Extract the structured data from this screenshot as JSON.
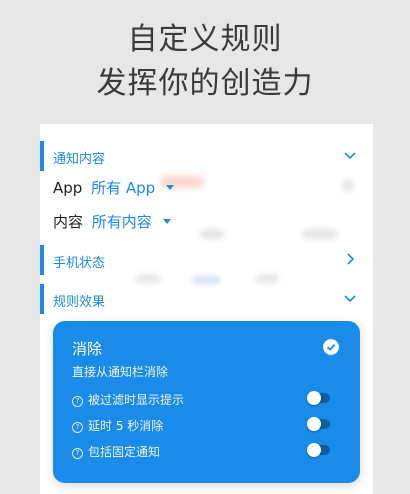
{
  "promo": {
    "line1": "自定义规则",
    "line2": "发挥你的创造力"
  },
  "sections": {
    "notification_content": "通知内容",
    "phone_state": "手机状态",
    "rule_effect": "规则效果"
  },
  "filters": {
    "app_label": "App",
    "app_value": "所有 App",
    "content_label": "内容",
    "content_value": "所有内容"
  },
  "effect_panel": {
    "title": "消除",
    "description": "直接从通知栏消除",
    "options": [
      {
        "label": "被过滤时显示提示",
        "enabled": false
      },
      {
        "label": "延时 5 秒消除",
        "enabled": false
      },
      {
        "label": "包括固定通知",
        "enabled": false
      }
    ]
  },
  "colors": {
    "accent": "#1a8be8",
    "page_background": "#e7e7e7"
  },
  "icons": [
    "chevron-down-icon",
    "chevron-right-icon",
    "caret-down-icon",
    "check-circle-icon",
    "help-circle-icon"
  ]
}
